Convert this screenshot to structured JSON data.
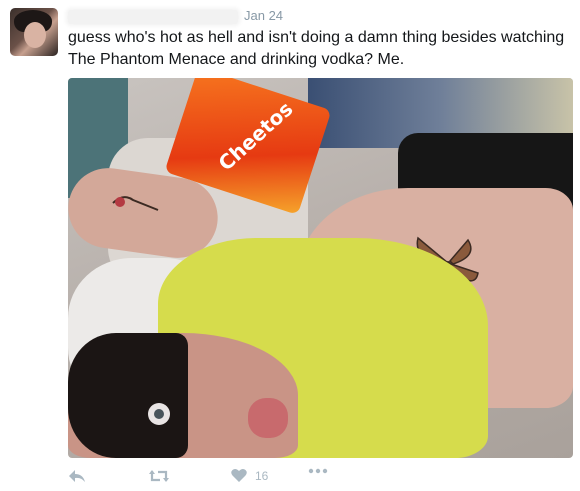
{
  "tweet": {
    "date": "Jan 24",
    "text": "guess who's hot as hell and isn't doing a damn thing besides watching The Phantom Menace and drinking vodka? Me.",
    "photo_brand_text": "Cheetos",
    "actions": {
      "like_count": "16"
    }
  },
  "icons": {
    "reply": "reply-icon",
    "retweet": "retweet-icon",
    "like": "heart-icon",
    "more": "more-icon"
  },
  "colors": {
    "text": "#14171a",
    "muted": "#8899a6",
    "action": "#aab8c2"
  }
}
